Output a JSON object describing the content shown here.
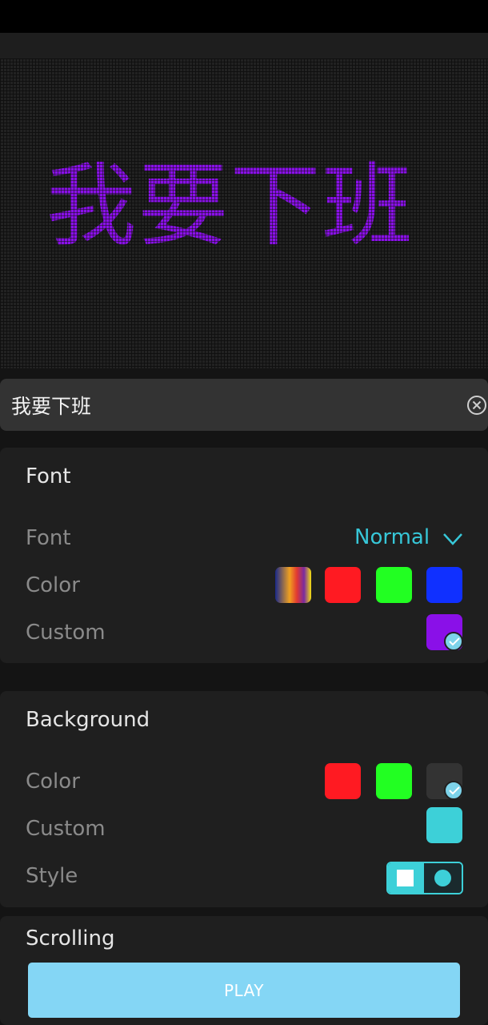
{
  "display": {
    "text": "我要下班",
    "text_color": "#8a10e8"
  },
  "input": {
    "value": "我要下班"
  },
  "font_section": {
    "title": "Font",
    "font_label": "Font",
    "font_value": "Normal",
    "color_label": "Color",
    "custom_label": "Custom",
    "swatches": [
      "gradient",
      "#ff1a22",
      "#22ff22",
      "#1030ff"
    ],
    "custom_color": "#8a10e8"
  },
  "background_section": {
    "title": "Background",
    "color_label": "Color",
    "custom_label": "Custom",
    "style_label": "Style",
    "swatches": [
      "#ff1a22",
      "#22ff22",
      "#333333"
    ],
    "custom_color": "#3dd0d8"
  },
  "scrolling_section": {
    "title": "Scrolling"
  },
  "play_button": {
    "label": "PLAY"
  }
}
